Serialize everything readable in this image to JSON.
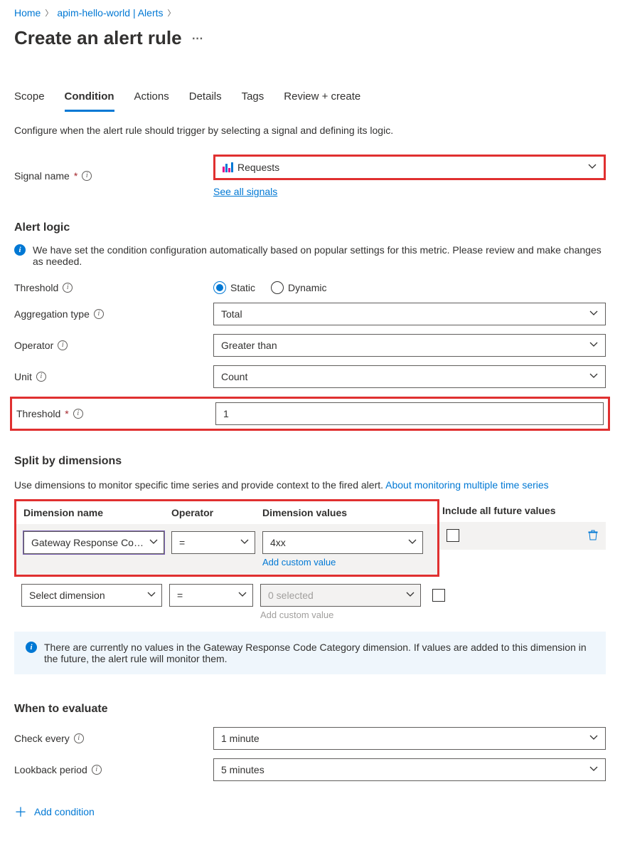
{
  "breadcrumb": {
    "home": "Home",
    "mid": "apim-hello-world | Alerts"
  },
  "title": "Create an alert rule",
  "tabs": {
    "scope": "Scope",
    "condition": "Condition",
    "actions": "Actions",
    "details": "Details",
    "tags": "Tags",
    "review": "Review + create"
  },
  "desc": "Configure when the alert rule should trigger by selecting a signal and defining its logic.",
  "signal": {
    "label": "Signal name",
    "value": "Requests",
    "link": "See all signals"
  },
  "alertLogic": {
    "heading": "Alert logic",
    "callout": "We have set the condition configuration automatically based on popular settings for this metric. Please review and make changes as needed.",
    "threshold_lbl": "Threshold",
    "static": "Static",
    "dynamic": "Dynamic",
    "agg_lbl": "Aggregation type",
    "agg_val": "Total",
    "op_lbl": "Operator",
    "op_val": "Greater than",
    "unit_lbl": "Unit",
    "unit_val": "Count",
    "thval_lbl": "Threshold",
    "thval": "1"
  },
  "split": {
    "heading": "Split by dimensions",
    "desc_a": "Use dimensions to monitor specific time series and provide context to the fired alert. ",
    "desc_link": "About monitoring multiple time series",
    "h_name": "Dimension name",
    "h_op": "Operator",
    "h_vals": "Dimension values",
    "h_inc": "Include all future values",
    "r1_name": "Gateway Response Co…",
    "r1_op": "=",
    "r1_val": "4xx",
    "add_custom": "Add custom value",
    "r2_name": "Select dimension",
    "r2_op": "=",
    "r2_val": "0 selected",
    "callout2": "There are currently no values in the Gateway Response Code Category dimension. If values are added to this dimension in the future, the alert rule will monitor them."
  },
  "eval": {
    "heading": "When to evaluate",
    "check_lbl": "Check every",
    "check_val": "1 minute",
    "look_lbl": "Lookback period",
    "look_val": "5 minutes"
  },
  "addcond": "Add condition"
}
